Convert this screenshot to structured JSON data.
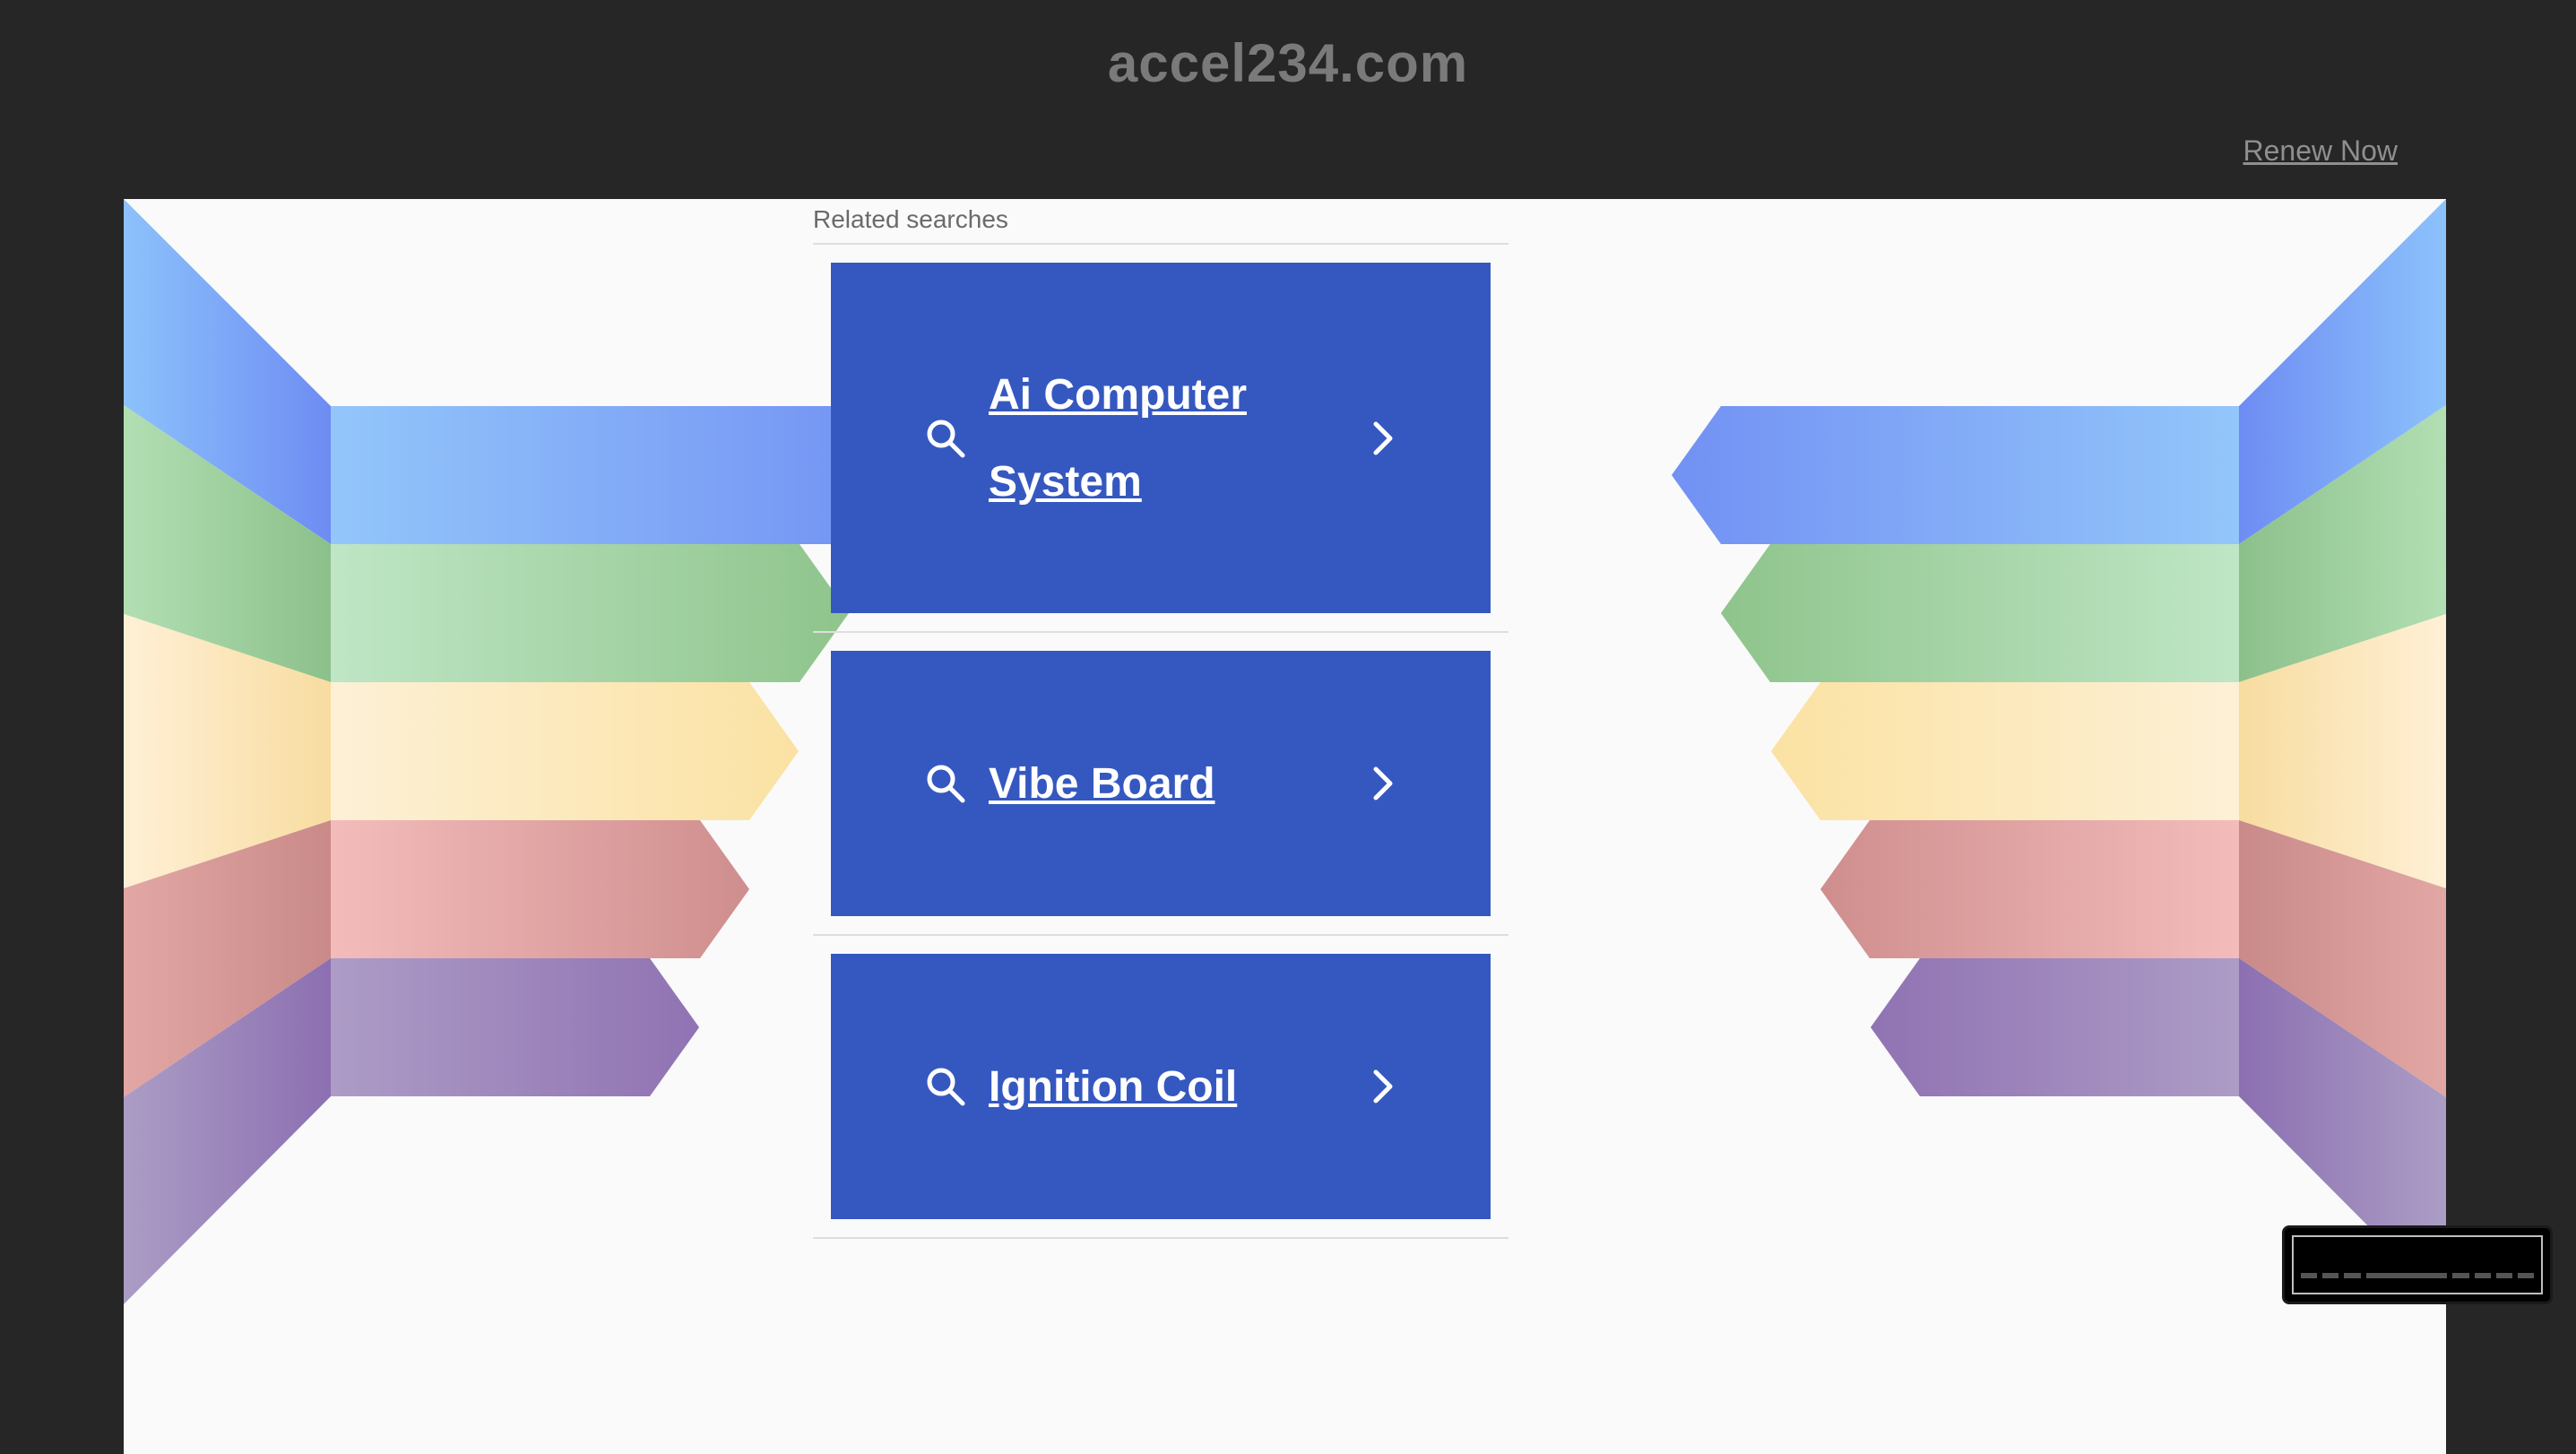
{
  "header": {
    "site_title": "accel234.com",
    "renew_label": "Renew Now"
  },
  "related": {
    "heading": "Related searches",
    "items": [
      {
        "label": "Ai Computer System",
        "icon": "search-icon",
        "chevron": "chevron-right-icon"
      },
      {
        "label": "Vibe Board",
        "icon": "search-icon",
        "chevron": "chevron-right-icon"
      },
      {
        "label": "Ignition Coil",
        "icon": "search-icon",
        "chevron": "chevron-right-icon"
      }
    ]
  },
  "colors": {
    "background": "#262626",
    "panel": "#fafafa",
    "card": "#3558c0",
    "title": "#7a7a7a",
    "ribbon_blue": "#7b9cf5",
    "ribbon_green": "#98cc97",
    "ribbon_yellow": "#fbe4a8",
    "ribbon_red": "#dca0a0",
    "ribbon_purple": "#9d86c0"
  }
}
